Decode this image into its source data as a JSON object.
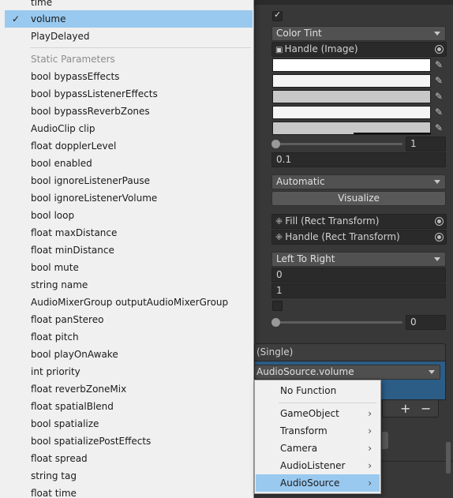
{
  "inspector": {
    "color_transition": "Color Tint",
    "target_graphic": "Handle (Image)",
    "color_multiplier": "1",
    "fade_duration": "0.1",
    "navigation": "Automatic",
    "visualize_label": "Visualize",
    "fill_rect": "Fill (Rect Transform)",
    "handle_rect": "Handle (Rect Transform)",
    "direction": "Left To Right",
    "min_value": "0",
    "max_value": "1",
    "value": "0",
    "event_header": "(Single)",
    "function_selector": "AudioSource.volume",
    "add_label": "+",
    "remove_label": "−",
    "colors": {
      "normal": "#ffffff",
      "highlighted": "#f5f5f5",
      "pressed": "#c8c8c8",
      "selected": "#f5f5f5",
      "disabled": "#c8c8c8",
      "event_panel": "#2c5d87",
      "selection": "#99c9ef"
    }
  },
  "menu_left": {
    "items": [
      "time",
      "volume",
      "PlayDelayed",
      "Static Parameters",
      "bool bypassEffects",
      "bool bypassListenerEffects",
      "bool bypassReverbZones",
      "AudioClip clip",
      "float dopplerLevel",
      "bool enabled",
      "bool ignoreListenerPause",
      "bool ignoreListenerVolume",
      "bool loop",
      "float maxDistance",
      "float minDistance",
      "bool mute",
      "string name",
      "AudioMixerGroup outputAudioMixerGroup",
      "float panStereo",
      "float pitch",
      "bool playOnAwake",
      "int priority",
      "float reverbZoneMix",
      "float spatialBlend",
      "bool spatialize",
      "bool spatializePostEffects",
      "float spread",
      "string tag",
      "float time"
    ],
    "check_glyph": "✓"
  },
  "menu_right": {
    "no_function": "No Function",
    "items": [
      "GameObject",
      "Transform",
      "Camera",
      "AudioListener",
      "AudioSource"
    ],
    "chevron": "›"
  }
}
